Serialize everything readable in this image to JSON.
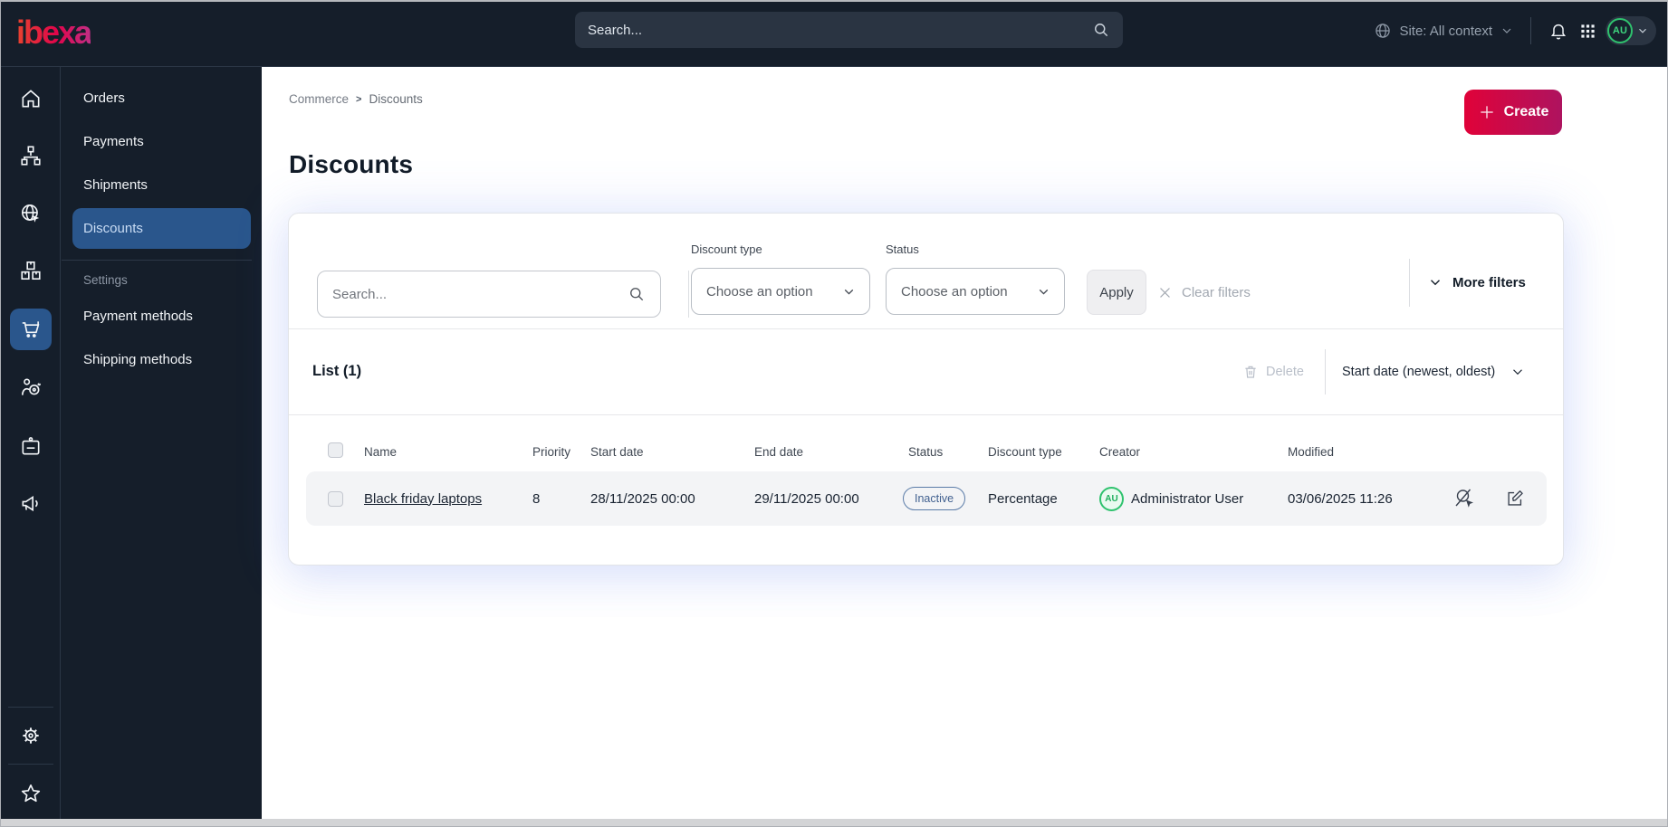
{
  "topbar": {
    "logo": "ibexa",
    "search_placeholder": "Search...",
    "site_label": "Site: All context",
    "avatar_initials": "AU"
  },
  "sidebar": {
    "menu_items": [
      {
        "label": "Orders"
      },
      {
        "label": "Payments"
      },
      {
        "label": "Shipments"
      },
      {
        "label": "Discounts",
        "active": true
      }
    ],
    "section_label": "Settings",
    "settings_items": [
      {
        "label": "Payment methods"
      },
      {
        "label": "Shipping methods"
      }
    ]
  },
  "breadcrumb": {
    "first": "Commerce",
    "last": "Discounts"
  },
  "page": {
    "title": "Discounts",
    "create_label": "Create"
  },
  "filters": {
    "search_placeholder": "Search...",
    "discount_type_label": "Discount type",
    "discount_type_value": "Choose an option",
    "status_label": "Status",
    "status_value": "Choose an option",
    "apply_label": "Apply",
    "clear_label": "Clear filters",
    "more_label": "More filters"
  },
  "list": {
    "title": "List (1)",
    "delete_label": "Delete",
    "sort_label": "Start date (newest, oldest)",
    "columns": [
      "Name",
      "Priority",
      "Start date",
      "End date",
      "Status",
      "Discount type",
      "Creator",
      "Modified"
    ],
    "rows": [
      {
        "name": "Black friday laptops",
        "priority": "8",
        "start_date": "28/11/2025 00:00",
        "end_date": "29/11/2025 00:00",
        "status": "Inactive",
        "discount_type": "Percentage",
        "creator": "Administrator User",
        "creator_initials": "AU",
        "modified": "03/06/2025 11:26"
      }
    ]
  },
  "colors": {
    "accent_gradient_start": "#e00239",
    "accent_gradient_end": "#ae135f",
    "active_blue": "#2a568c",
    "badge_blue": "#41608f",
    "avatar_green": "#2fc26e",
    "sidebar_bg": "#151e2a"
  }
}
